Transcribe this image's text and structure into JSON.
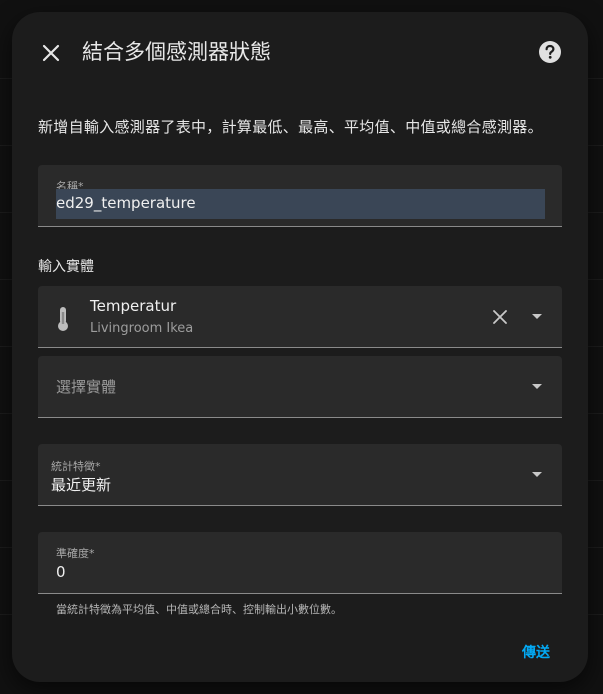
{
  "dialog": {
    "title": "結合多個感測器狀態",
    "description": "新增自輸入感測器了表中，計算最低、最高、平均值、中值或總合感測器。"
  },
  "name_field": {
    "label": "名稱*",
    "value": "ed29_temperature"
  },
  "entities_section": {
    "label": "輸入實體",
    "entity": {
      "name": "Temperatur",
      "area": "Livingroom Ikea",
      "icon": "thermometer-icon"
    },
    "select_placeholder": "選擇實體"
  },
  "statistic_field": {
    "label": "統計特徵*",
    "value": "最近更新"
  },
  "precision_field": {
    "label": "準確度*",
    "value": "0",
    "helper": "當統計特徵為平均值、中值或總合時、控制輸出小數位數。"
  },
  "actions": {
    "submit_label": "傳送"
  },
  "colors": {
    "accent": "#03a9f4",
    "surface": "#1c1c1c",
    "field": "#2a2a2a"
  }
}
